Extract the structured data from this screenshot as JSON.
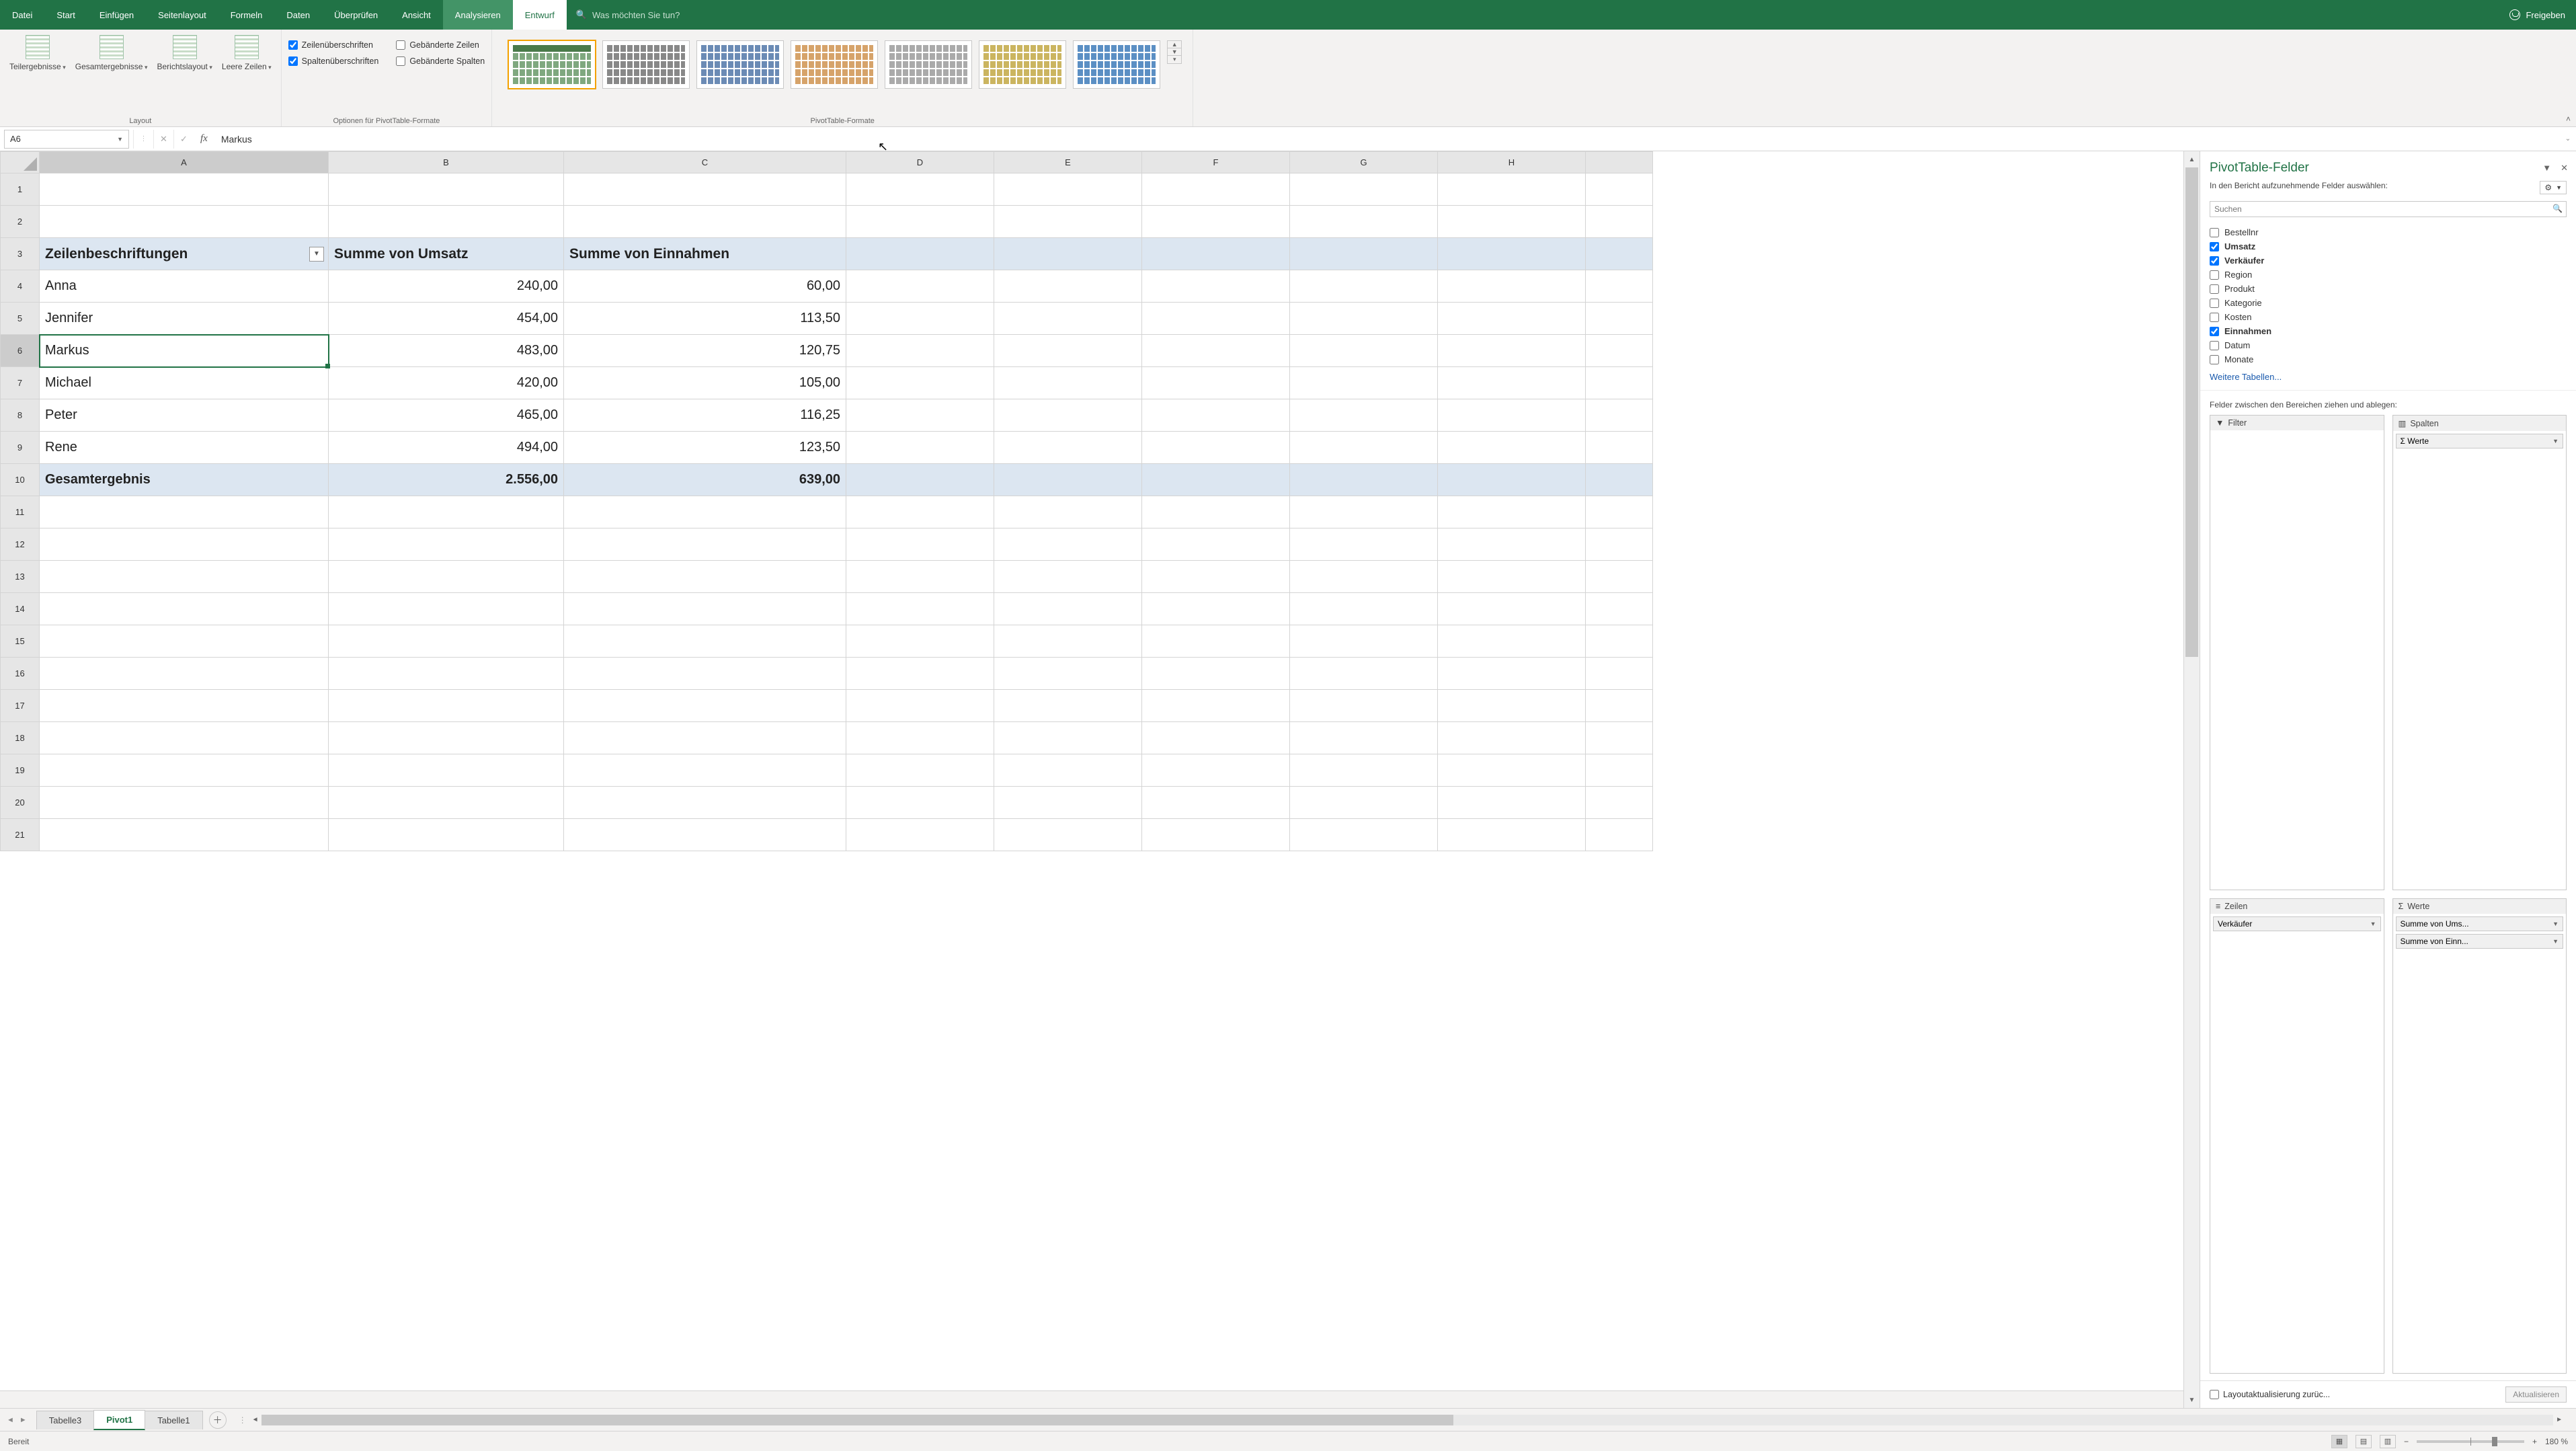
{
  "menu": {
    "tabs": [
      "Datei",
      "Start",
      "Einfügen",
      "Seitenlayout",
      "Formeln",
      "Daten",
      "Überprüfen",
      "Ansicht",
      "Analysieren",
      "Entwurf"
    ],
    "active": "Entwurf",
    "hover": "Analysieren",
    "tellme_placeholder": "Was möchten Sie tun?",
    "share": "Freigeben"
  },
  "ribbon": {
    "layout": {
      "subtotals": "Teilergebnisse",
      "grandtotals": "Gesamtergebnisse",
      "reportlayout": "Berichtslayout",
      "blankrows": "Leere Zeilen",
      "group_label": "Layout"
    },
    "options": {
      "row_headers": "Zeilenüberschriften",
      "col_headers": "Spaltenüberschriften",
      "banded_rows": "Gebänderte Zeilen",
      "banded_cols": "Gebänderte Spalten",
      "group_label": "Optionen für PivotTable-Formate"
    },
    "styles_label": "PivotTable-Formate"
  },
  "formula_bar": {
    "name": "A6",
    "value": "Markus"
  },
  "columns": [
    "A",
    "B",
    "C",
    "D",
    "E",
    "F",
    "G",
    "H"
  ],
  "pivot": {
    "header": [
      "Zeilenbeschriftungen",
      "Summe von Umsatz",
      "Summe von Einnahmen"
    ],
    "rows": [
      {
        "label": "Anna",
        "umsatz": "240,00",
        "einn": "60,00"
      },
      {
        "label": "Jennifer",
        "umsatz": "454,00",
        "einn": "113,50"
      },
      {
        "label": "Markus",
        "umsatz": "483,00",
        "einn": "120,75"
      },
      {
        "label": "Michael",
        "umsatz": "420,00",
        "einn": "105,00"
      },
      {
        "label": "Peter",
        "umsatz": "465,00",
        "einn": "116,25"
      },
      {
        "label": "Rene",
        "umsatz": "494,00",
        "einn": "123,50"
      }
    ],
    "total": {
      "label": "Gesamtergebnis",
      "umsatz": "2.556,00",
      "einn": "639,00"
    }
  },
  "panel": {
    "title": "PivotTable-Felder",
    "subtitle": "In den Bericht aufzunehmende Felder auswählen:",
    "search_placeholder": "Suchen",
    "fields": [
      {
        "name": "Bestellnr",
        "checked": false
      },
      {
        "name": "Umsatz",
        "checked": true
      },
      {
        "name": "Verkäufer",
        "checked": true
      },
      {
        "name": "Region",
        "checked": false
      },
      {
        "name": "Produkt",
        "checked": false
      },
      {
        "name": "Kategorie",
        "checked": false
      },
      {
        "name": "Kosten",
        "checked": false
      },
      {
        "name": "Einnahmen",
        "checked": true
      },
      {
        "name": "Datum",
        "checked": false
      },
      {
        "name": "Monate",
        "checked": false
      }
    ],
    "more_tables": "Weitere Tabellen...",
    "drag_label": "Felder zwischen den Bereichen ziehen und ablegen:",
    "areas": {
      "filter": "Filter",
      "columns": "Spalten",
      "rows": "Zeilen",
      "values": "Werte",
      "columns_items": [
        "Σ  Werte"
      ],
      "rows_items": [
        "Verkäufer"
      ],
      "values_items": [
        "Summe von Ums...",
        "Summe von Einn..."
      ]
    },
    "defer": "Layoutaktualisierung zurüc...",
    "update_btn": "Aktualisieren"
  },
  "sheet_tabs": [
    "Tabelle3",
    "Pivot1",
    "Tabelle1"
  ],
  "active_sheet": "Pivot1",
  "status": {
    "ready": "Bereit",
    "zoom": "180 %"
  }
}
